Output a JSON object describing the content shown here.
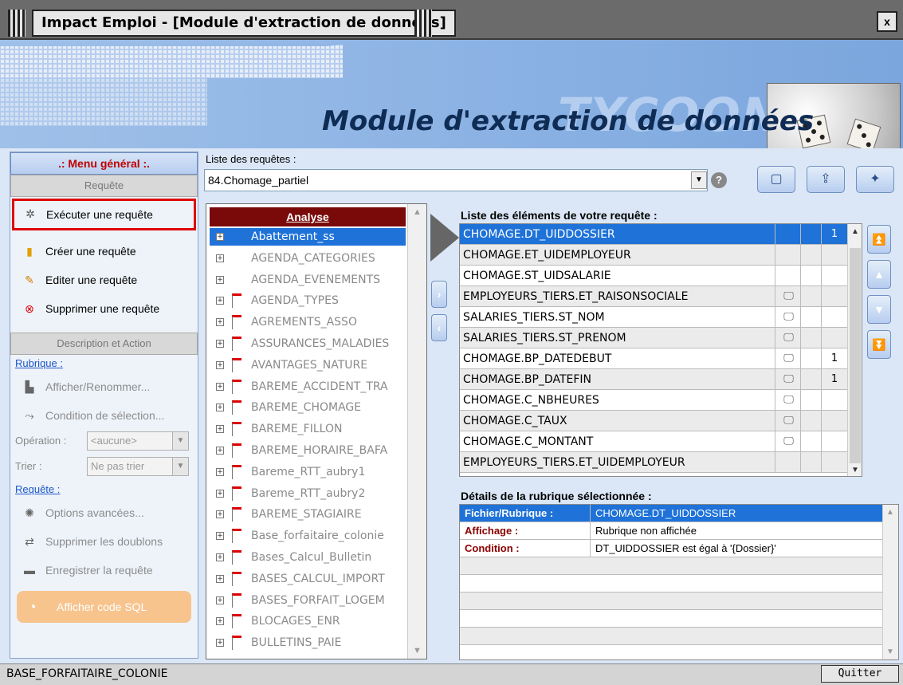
{
  "window": {
    "title": "Impact Emploi - [Module d'extraction de données]",
    "close_label": "x"
  },
  "banner": {
    "brand": "TYCOON",
    "title": "Module d'extraction de données"
  },
  "sidebar": {
    "menu_title": ".: Menu général :.",
    "section_request": "Requête",
    "items": [
      {
        "label": "Exécuter une requête",
        "icon": "run-gear-icon"
      },
      {
        "label": "Créer une requête",
        "icon": "create-icon"
      },
      {
        "label": "Editer une requête",
        "icon": "edit-icon"
      },
      {
        "label": "Supprimer une requête",
        "icon": "delete-icon"
      }
    ],
    "section_desc": "Description et Action",
    "rubrique_link": "Rubrique :",
    "rubrique_items": [
      {
        "label": "Afficher/Renommer...",
        "icon": "rename-icon"
      },
      {
        "label": "Condition de sélection...",
        "icon": "condition-icon"
      }
    ],
    "operation_label": "Opération :",
    "operation_value": "<aucune>",
    "sort_label": "Trier :",
    "sort_value": "Ne pas trier",
    "requete_link": "Requête :",
    "requete_items": [
      {
        "label": "Options avancées...",
        "icon": "options-icon"
      },
      {
        "label": "Supprimer les doublons",
        "icon": "dedupe-icon"
      },
      {
        "label": "Enregistrer la requête",
        "icon": "save-icon"
      }
    ],
    "sql_button": "Afficher code SQL"
  },
  "requests": {
    "label": "Liste des requêtes :",
    "selected": "84.Chomage_partiel"
  },
  "tree": {
    "header": "Analyse",
    "items": [
      "Abattement_ss",
      "AGENDA_CATEGORIES",
      "AGENDA_EVENEMENTS",
      "AGENDA_TYPES",
      "AGREMENTS_ASSO",
      "ASSURANCES_MALADIES",
      "AVANTAGES_NATURE",
      "BAREME_ACCIDENT_TRA",
      "BAREME_CHOMAGE",
      "BAREME_FILLON",
      "BAREME_HORAIRE_BAFA",
      "Bareme_RTT_aubry1",
      "Bareme_RTT_aubry2",
      "BAREME_STAGIAIRE",
      "Base_forfaitaire_colonie",
      "Bases_Calcul_Bulletin",
      "BASES_CALCUL_IMPORT",
      "BASES_FORFAIT_LOGEM",
      "BLOCAGES_ENR",
      "BULLETINS_PAIE"
    ]
  },
  "elements": {
    "label": "Liste des éléments de votre requête :",
    "rows": [
      {
        "name": "CHOMAGE.DT_UIDDOSSIER",
        "display": false,
        "order": "1"
      },
      {
        "name": "CHOMAGE.ET_UIDEMPLOYEUR",
        "display": false,
        "order": ""
      },
      {
        "name": "CHOMAGE.ST_UIDSALARIE",
        "display": false,
        "order": ""
      },
      {
        "name": "EMPLOYEURS_TIERS.ET_RAISONSOCIALE",
        "display": true,
        "order": ""
      },
      {
        "name": "SALARIES_TIERS.ST_NOM",
        "display": true,
        "order": ""
      },
      {
        "name": "SALARIES_TIERS.ST_PRENOM",
        "display": true,
        "order": ""
      },
      {
        "name": "CHOMAGE.BP_DATEDEBUT",
        "display": true,
        "order": "1"
      },
      {
        "name": "CHOMAGE.BP_DATEFIN",
        "display": true,
        "order": "1"
      },
      {
        "name": "CHOMAGE.C_NBHEURES",
        "display": true,
        "order": ""
      },
      {
        "name": "CHOMAGE.C_TAUX",
        "display": true,
        "order": ""
      },
      {
        "name": "CHOMAGE.C_MONTANT",
        "display": true,
        "order": ""
      },
      {
        "name": "EMPLOYEURS_TIERS.ET_UIDEMPLOYEUR",
        "display": false,
        "order": ""
      }
    ]
  },
  "details": {
    "label": "Détails de la rubrique sélectionnée :",
    "rows": [
      {
        "key": "Fichier/Rubrique :",
        "value": "CHOMAGE.DT_UIDDOSSIER"
      },
      {
        "key": "Affichage :",
        "value": "Rubrique non affichée"
      },
      {
        "key": "Condition :",
        "value": "DT_UIDDOSSIER est égal à '{Dossier}'"
      }
    ]
  },
  "status": {
    "text": "BASE_FORFAITAIRE_COLONIE",
    "quit": "Quitter"
  }
}
